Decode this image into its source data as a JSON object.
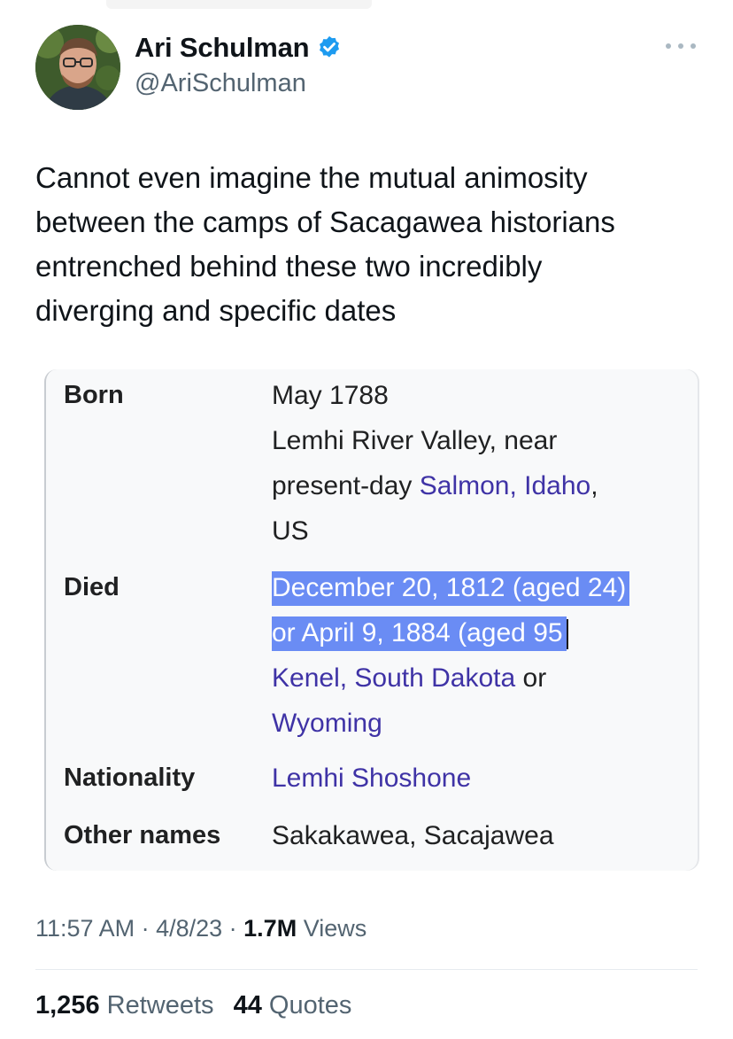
{
  "author": {
    "name": "Ari Schulman",
    "handle": "@AriSchulman",
    "verified_color": "#1d9bf0"
  },
  "tweet": {
    "text": "Cannot even imagine the mutual animosity\nbetween the camps of Sacagawea historians\nentrenched behind these two incredibly\ndiverging and specific dates"
  },
  "infobox": {
    "born": {
      "label": "Born",
      "date": "May 1788",
      "place_line1": "Lemhi River Valley, near",
      "place_prefix": "present-day ",
      "place_link": "Salmon, Idaho",
      "place_suffix": ",",
      "country": "US"
    },
    "died": {
      "label": "Died",
      "date_option1": "December 20, 1812 (aged 24)",
      "date_option2": "or April 9, 1884 (aged 95",
      "place_link1": "Kenel, South Dakota",
      "place_or": " or",
      "place_link2": "Wyoming"
    },
    "nationality": {
      "label": "Nationality",
      "value": "Lemhi Shoshone"
    },
    "other_names": {
      "label": "Other names",
      "value": "Sakakawea, Sacajawea"
    },
    "link_color": "#3f33a6",
    "highlight_color": "#6a8cf4"
  },
  "meta": {
    "time": "11:57 AM",
    "sep1": " · ",
    "date": "4/8/23",
    "sep2": " · ",
    "views_count": "1.7M",
    "views_label": " Views"
  },
  "stats": {
    "retweets_count": "1,256",
    "retweets_label": " Retweets",
    "quotes_count": "44",
    "quotes_label": " Quotes"
  },
  "icons": {
    "verified": "verified-badge-icon",
    "more": "more-options-icon"
  }
}
